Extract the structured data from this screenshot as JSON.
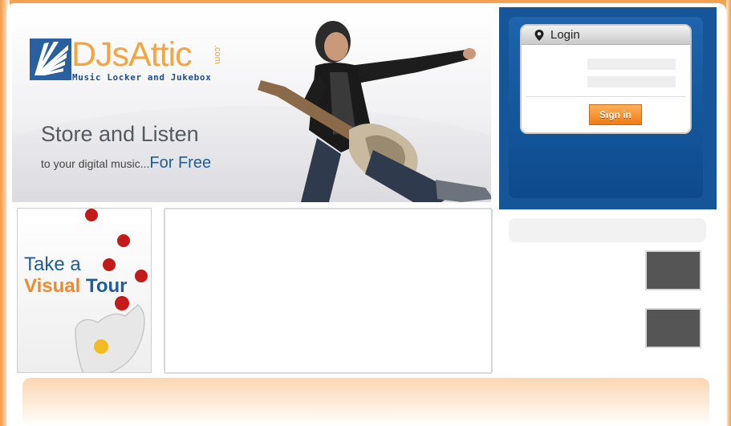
{
  "brand": {
    "name": "DJsAttic",
    "dotcom": ".com",
    "tagline": "Music Locker and Jukebox"
  },
  "hero": {
    "headline": "Store and Listen",
    "subline_prefix": "to your digital music...",
    "subline_emphasis": "For Free"
  },
  "login": {
    "title": "Login",
    "username_value": "",
    "password_value": "",
    "signin_label": "Sign in"
  },
  "tour": {
    "line1": "Take a",
    "visual": "Visual",
    "tour": "Tour"
  },
  "icons": {
    "logo": "rays-logo-mark",
    "login_pin": "map-pin-icon"
  },
  "colors": {
    "frame_orange": "#f19a47",
    "brand_blue": "#155598",
    "brand_orange": "#f3a640",
    "button_orange": "#f07a16",
    "link_blue": "#1f5d98"
  }
}
